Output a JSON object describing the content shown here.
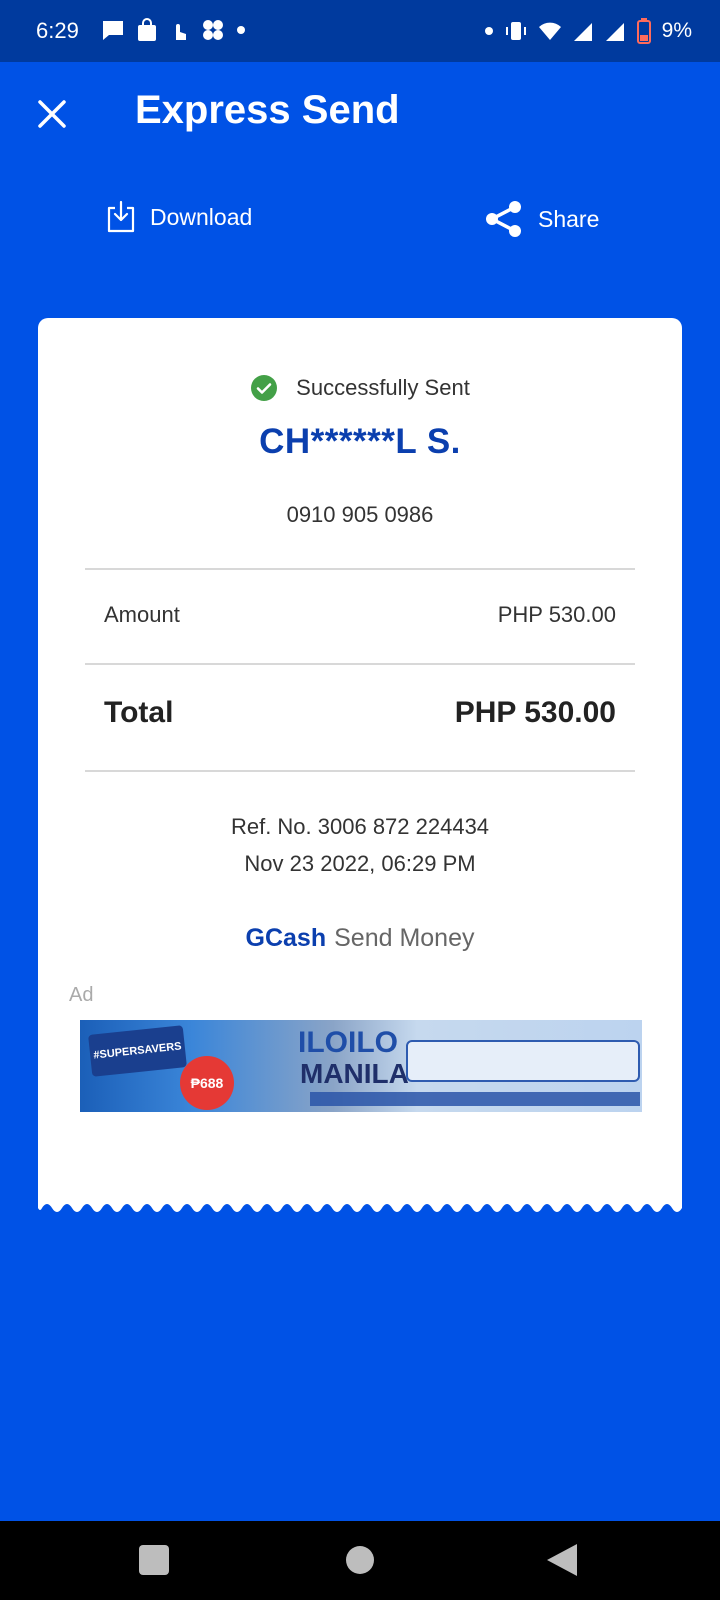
{
  "status_bar": {
    "time": "6:29",
    "battery": "9%"
  },
  "header": {
    "title": "Express Send"
  },
  "actions": {
    "download_label": "Download",
    "share_label": "Share"
  },
  "receipt": {
    "status": "Successfully Sent",
    "recipient": "CH******L S.",
    "phone": "0910 905 0986",
    "amount_label": "Amount",
    "amount_value": "PHP 530.00",
    "total_label": "Total",
    "total_value": "PHP 530.00",
    "ref_no": "Ref. No. 3006 872 224434",
    "datetime": "Nov 23 2022, 06:29 PM",
    "brand": "GCash",
    "brand_sub": "Send Money"
  },
  "ad": {
    "label": "Ad",
    "super": "#SUPERSAVERS",
    "price": "₱688",
    "headline_1": "ILOILO",
    "headline_2": "MANILA"
  },
  "colors": {
    "background": "#0052e6",
    "status_bar": "#003a9e",
    "brand_blue": "#0b3fae",
    "success_green": "#43a047"
  }
}
